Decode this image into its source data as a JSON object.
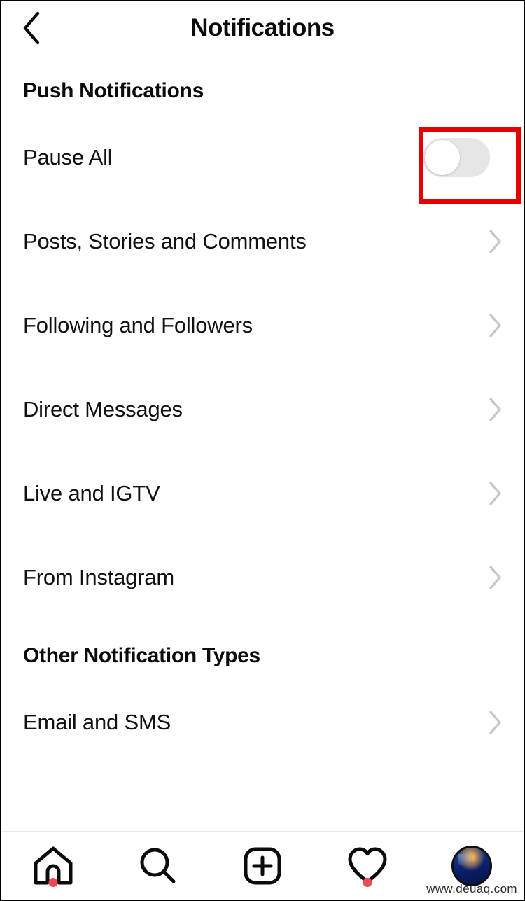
{
  "header": {
    "title": "Notifications",
    "back_icon": "chevron-left-icon"
  },
  "sections": [
    {
      "id": "push-notifications",
      "title": "Push Notifications",
      "rows": [
        {
          "label": "Pause All",
          "control": "toggle",
          "toggle_state": "off",
          "highlighted": true
        },
        {
          "label": "Posts, Stories and Comments",
          "control": "chevron"
        },
        {
          "label": "Following and Followers",
          "control": "chevron"
        },
        {
          "label": "Direct Messages",
          "control": "chevron"
        },
        {
          "label": "Live and IGTV",
          "control": "chevron"
        },
        {
          "label": "From Instagram",
          "control": "chevron"
        }
      ]
    },
    {
      "id": "other-notification-types",
      "title": "Other Notification Types",
      "rows": [
        {
          "label": "Email and SMS",
          "control": "chevron"
        }
      ]
    }
  ],
  "bottom_nav": {
    "items": [
      {
        "icon": "home-icon",
        "badge_dot": true
      },
      {
        "icon": "search-icon",
        "badge_dot": false
      },
      {
        "icon": "add-post-icon",
        "badge_dot": false
      },
      {
        "icon": "heart-icon",
        "badge_dot": true
      },
      {
        "icon": "profile-avatar-icon",
        "badge_dot": false
      }
    ]
  },
  "watermark": "www.deuaq.com",
  "colors": {
    "highlight": "#e60000",
    "badge_dot": "#ed4956",
    "toggle_track_off": "#e6e6e6",
    "chevron": "#c8c8c8",
    "text": "#111111",
    "divider": "#e9e9e9"
  }
}
